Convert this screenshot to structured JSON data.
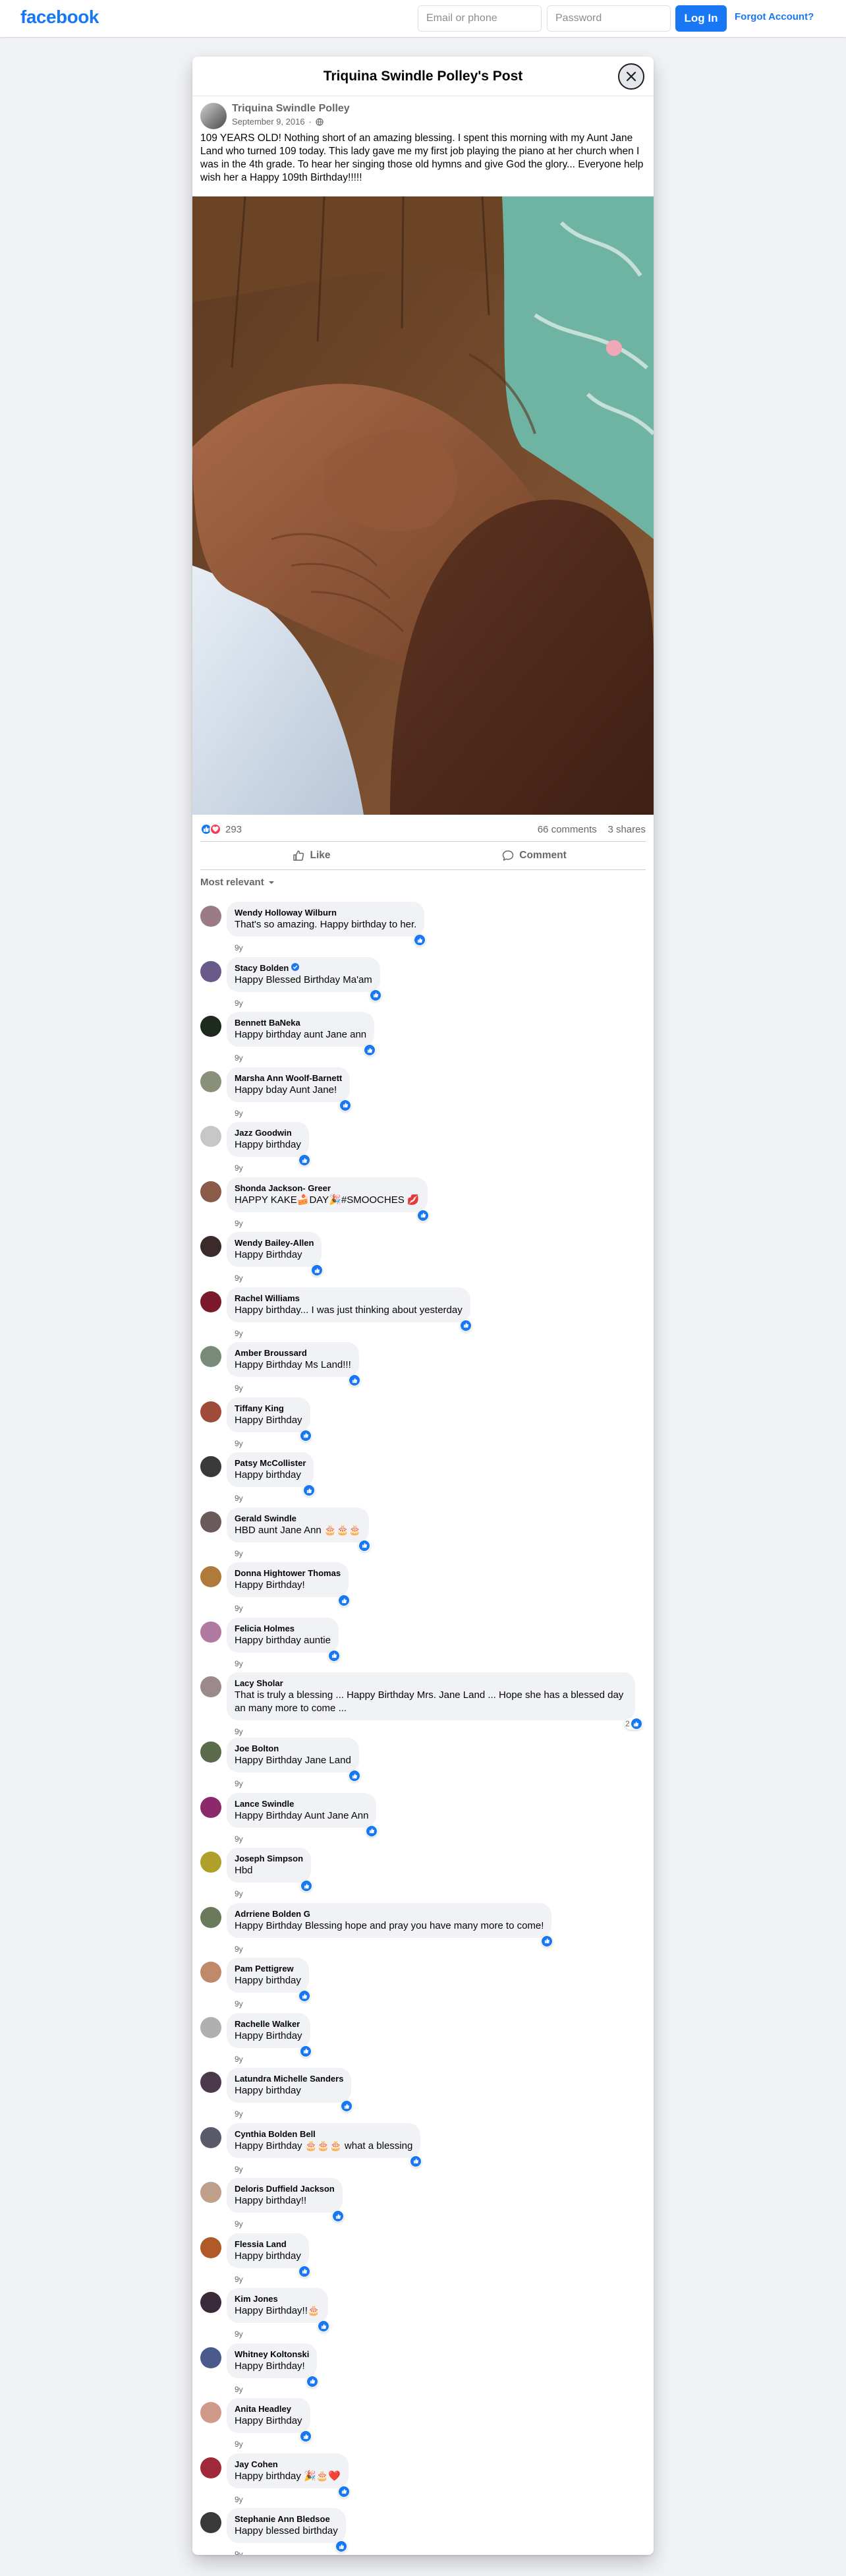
{
  "topbar": {
    "logo": "facebook",
    "email_placeholder": "Email or phone",
    "password_placeholder": "Password",
    "login_label": "Log In",
    "forgot_label": "Forgot Account?"
  },
  "post": {
    "title": "Triquina Swindle Polley's Post",
    "author": "Triquina Swindle Polley",
    "date": "September 9, 2016",
    "audience_icon": "globe-icon",
    "text": "109 YEARS OLD! Nothing short of an amazing blessing. I spent this morning with my Aunt Jane Land who turned 109 today. This lady gave me my first job playing the piano at her church when I was in the 4th grade. To hear her singing those old hymns and give God the glory...  Everyone help wish her a Happy 109th Birthday!!!!!",
    "reaction_count": "293",
    "comments_count": "66 comments",
    "shares_count": "3 shares",
    "like_label": "Like",
    "comment_label": "Comment",
    "sort_label": "Most relevant"
  },
  "colors": {
    "brand": "#1877f2",
    "love": "#f33e58"
  },
  "comments": [
    {
      "name": "Wendy Holloway Wilburn",
      "text": "That's so amazing. Happy birthday to her.",
      "time": "9y",
      "avatar": "#9a7b86"
    },
    {
      "name": "Stacy Bolden",
      "text": "Happy Blessed Birthday Ma'am",
      "time": "9y",
      "avatar": "#6a5a8a",
      "verified": true
    },
    {
      "name": "Bennett BaNeka",
      "text": "Happy birthday aunt Jane ann",
      "time": "9y",
      "avatar": "#1e2a1e"
    },
    {
      "name": "Marsha Ann Woolf-Barnett",
      "text": "Happy bday Aunt Jane!",
      "time": "9y",
      "avatar": "#8a8f7a"
    },
    {
      "name": "Jazz Goodwin",
      "text": "Happy birthday",
      "time": "9y",
      "avatar": "#c7c7c7"
    },
    {
      "name": "Shonda Jackson- Greer",
      "text": "HAPPY KAKE🍰DAY🎉#SMOOCHES 💋",
      "time": "9y",
      "avatar": "#8a5a4a"
    },
    {
      "name": "Wendy Bailey-Allen",
      "text": "Happy Birthday",
      "time": "9y",
      "avatar": "#3a2a2a"
    },
    {
      "name": "Rachel Williams",
      "text": "Happy birthday... I was just thinking about yesterday",
      "time": "9y",
      "avatar": "#7a1a2a"
    },
    {
      "name": "Amber Broussard",
      "text": "Happy Birthday Ms Land!!!",
      "time": "9y",
      "avatar": "#7a8a7a"
    },
    {
      "name": "Tiffany King",
      "text": "Happy Birthday",
      "time": "9y",
      "avatar": "#a04a3a"
    },
    {
      "name": "Patsy McCollister",
      "text": "Happy birthday",
      "time": "9y",
      "avatar": "#3a3a3a"
    },
    {
      "name": "Gerald Swindle",
      "text": "HBD aunt Jane Ann 🎂🎂🎂",
      "time": "9y",
      "avatar": "#6a5a5a"
    },
    {
      "name": "Donna Hightower Thomas",
      "text": "Happy Birthday!",
      "time": "9y",
      "avatar": "#b07a3a"
    },
    {
      "name": "Felicia Holmes",
      "text": "Happy birthday auntie",
      "time": "9y",
      "avatar": "#b07aa0"
    },
    {
      "name": "Lacy Sholar",
      "text": "That is truly a blessing ... Happy Birthday Mrs. Jane Land ... Hope she has a blessed day an many more to come ...",
      "time": "9y",
      "avatar": "#9a8a8a",
      "likes": "2"
    },
    {
      "name": "Joe Bolton",
      "text": "Happy Birthday Jane Land",
      "time": "9y",
      "avatar": "#5a6a4a"
    },
    {
      "name": "Lance Swindle",
      "text": "Happy Birthday Aunt Jane Ann",
      "time": "9y",
      "avatar": "#8a2a6a"
    },
    {
      "name": "Joseph Simpson",
      "text": "Hbd",
      "time": "9y",
      "avatar": "#b0a02a"
    },
    {
      "name": "Adrriene Bolden G",
      "text": "Happy Birthday Blessing hope and pray you have many more to come!",
      "time": "9y",
      "avatar": "#6a7a5a"
    },
    {
      "name": "Pam Pettigrew",
      "text": "Happy birthday",
      "time": "9y",
      "avatar": "#c08a6a"
    },
    {
      "name": "Rachelle Walker",
      "text": "Happy Birthday",
      "time": "9y",
      "avatar": "#b0b0b0"
    },
    {
      "name": "Latundra Michelle Sanders",
      "text": "Happy birthday",
      "time": "9y",
      "avatar": "#4a3a4a"
    },
    {
      "name": "Cynthia Bolden Bell",
      "text": "Happy Birthday 🎂🎂🎂 what a blessing",
      "time": "9y",
      "avatar": "#5a5a6a"
    },
    {
      "name": "Deloris Duffield Jackson",
      "text": "Happy birthday!!",
      "time": "9y",
      "avatar": "#c0a08a"
    },
    {
      "name": "Flessia Land",
      "text": "Happy birthday",
      "time": "9y",
      "avatar": "#b05a2a"
    },
    {
      "name": "Kim Jones",
      "text": "Happy Birthday!!🎂",
      "time": "9y",
      "avatar": "#3a2a3a"
    },
    {
      "name": "Whitney Koltonski",
      "text": "Happy Birthday!",
      "time": "9y",
      "avatar": "#4a5a8a"
    },
    {
      "name": "Anita Headley",
      "text": "Happy Birthday",
      "time": "9y",
      "avatar": "#d09a8a"
    },
    {
      "name": "Jay Cohen",
      "text": "Happy birthday 🎉🎂❤️",
      "time": "9y",
      "avatar": "#a02a3a"
    },
    {
      "name": "Stephanie Ann Bledsoe",
      "text": "Happy blessed birthday",
      "time": "9y",
      "avatar": "#3a3a3a"
    }
  ]
}
